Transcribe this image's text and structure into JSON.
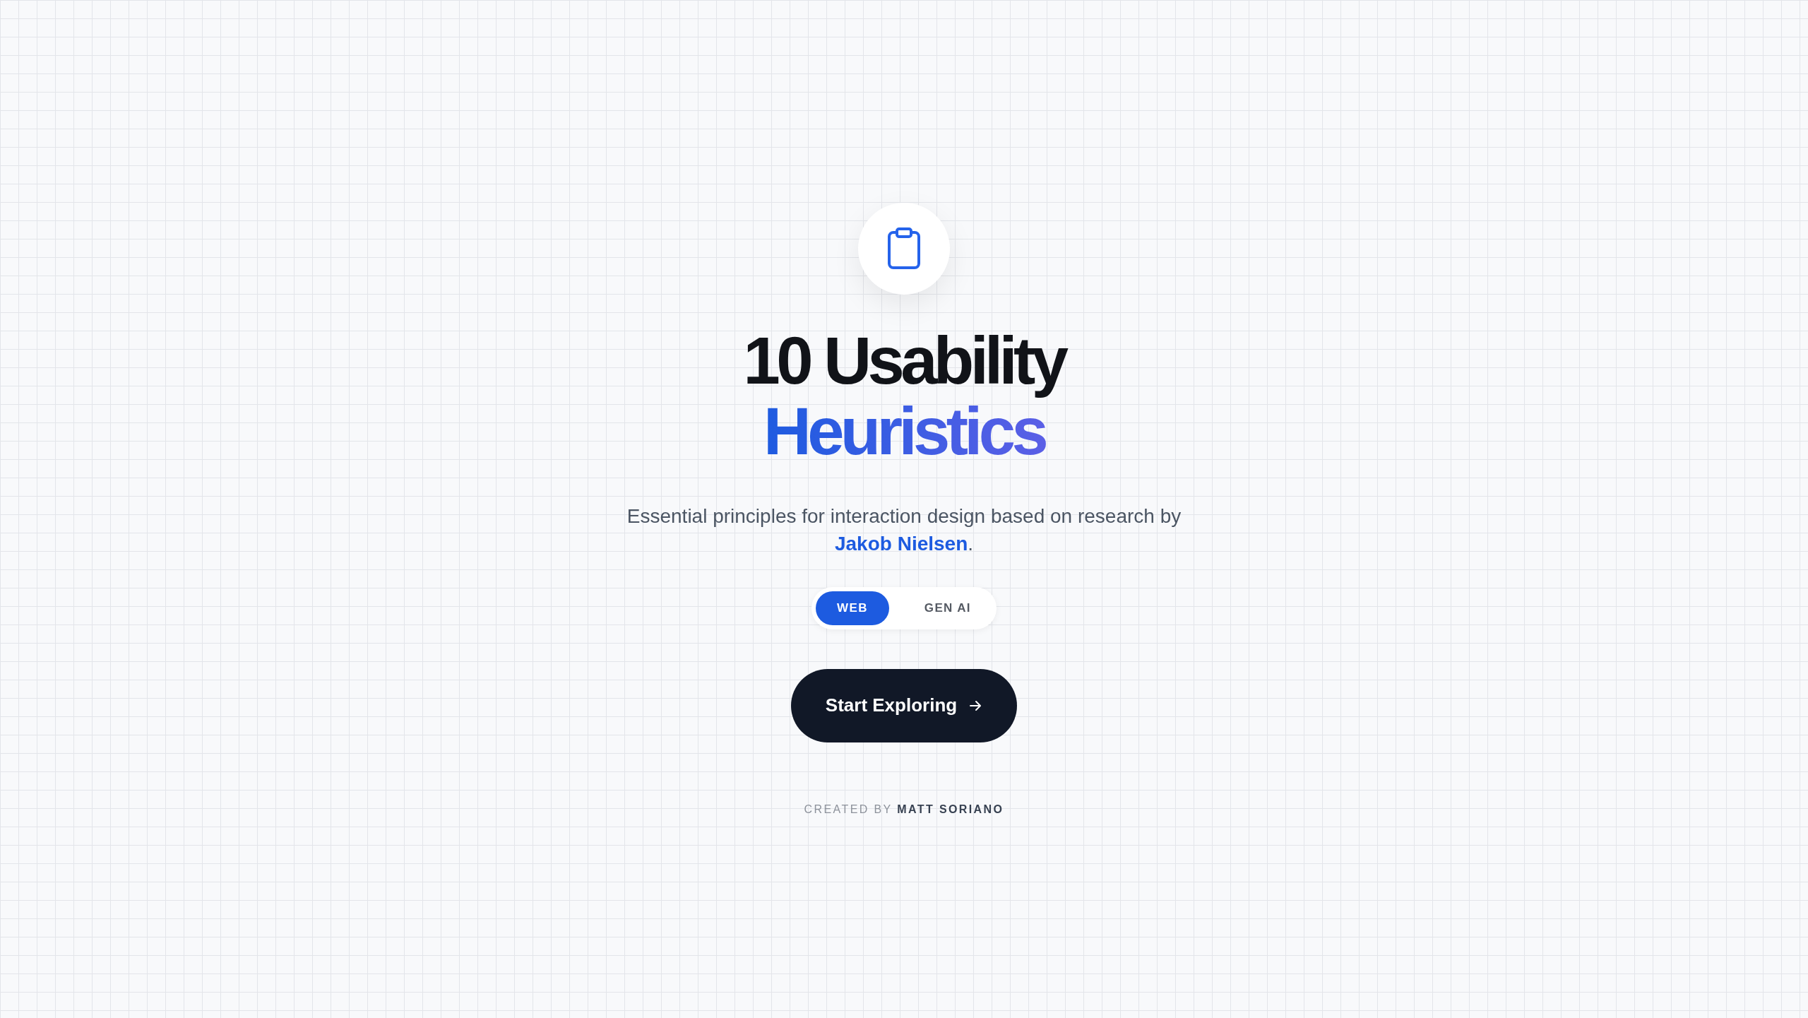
{
  "hero": {
    "title_line_1": "10 Usability",
    "title_line_2": "Heuristics",
    "subtitle": "Essential principles for interaction design based on research by",
    "subtitle_link": "Jakob Nielsen",
    "subtitle_end": "."
  },
  "mode_toggle": [
    {
      "label": "WEB",
      "selected": true
    },
    {
      "label": "GEN AI",
      "selected": false
    }
  ],
  "cta_button": {
    "label": "Start Exploring"
  },
  "footer": "CREATED BY **MATT SORIANO**"
}
